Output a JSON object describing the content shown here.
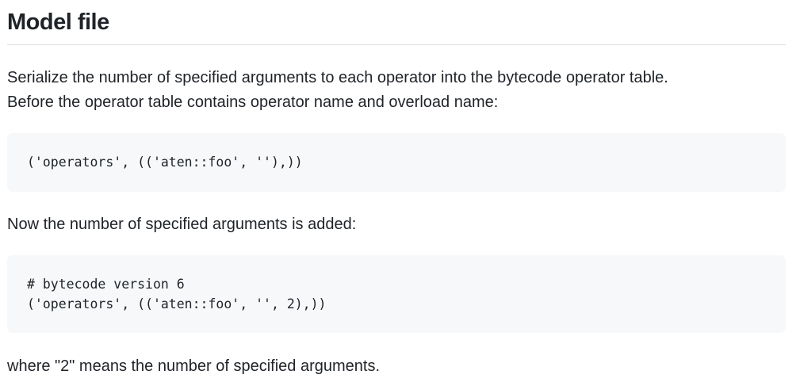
{
  "heading": "Model file",
  "intro": {
    "line1": "Serialize the number of specified arguments to each operator into the bytecode operator table.",
    "line2": "Before the operator table contains operator name and overload name:"
  },
  "code_before": {
    "lines": [
      "('operators', (('aten::foo', ''),))"
    ]
  },
  "middle_text": "Now the number of specified arguments is added:",
  "code_after": {
    "lines": [
      "# bytecode version 6",
      "('operators', (('aten::foo', '', 2),))"
    ]
  },
  "closing_text": "where \"2\" means the number of specified arguments."
}
